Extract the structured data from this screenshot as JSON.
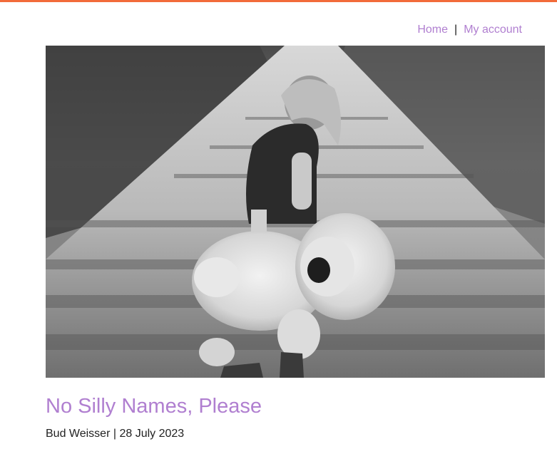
{
  "nav": {
    "home_label": "Home",
    "separator": "|",
    "account_label": "My account"
  },
  "hero": {
    "icon": "photo-child-with-stuffed-lion-icon"
  },
  "post": {
    "title": "No Silly Names, Please",
    "author": "Bud Weisser",
    "separator": "|",
    "date": "28 July 2023"
  },
  "colors": {
    "accent_bar": "#f26b3a",
    "link": "#b07fd0",
    "title": "#b07fd0",
    "text": "#222222"
  }
}
